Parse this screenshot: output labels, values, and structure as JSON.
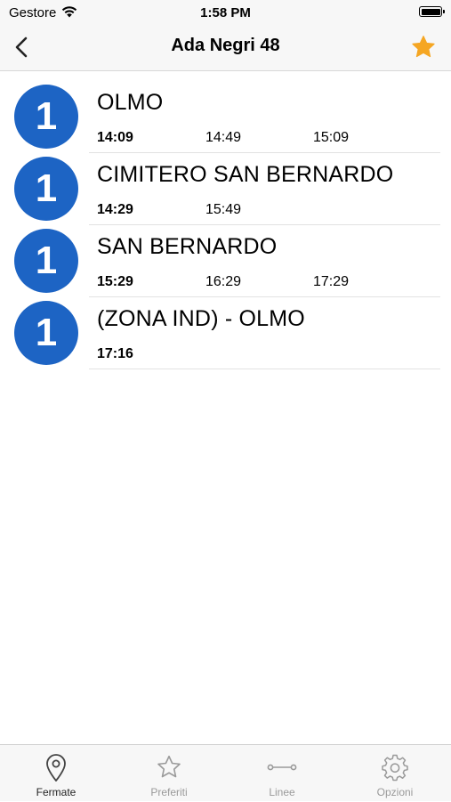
{
  "status": {
    "carrier": "Gestore",
    "time": "1:58 PM"
  },
  "nav": {
    "title": "Ada Negri 48",
    "favorite_color": "#f5a623"
  },
  "colors": {
    "line_badge": "#1d64c4"
  },
  "departures": [
    {
      "line": "1",
      "destination": "OLMO",
      "times": [
        "14:09",
        "14:49",
        "15:09"
      ]
    },
    {
      "line": "1",
      "destination": "CIMITERO SAN BERNARDO",
      "times": [
        "14:29",
        "15:49"
      ]
    },
    {
      "line": "1",
      "destination": "SAN BERNARDO",
      "times": [
        "15:29",
        "16:29",
        "17:29"
      ]
    },
    {
      "line": "1",
      "destination": "(ZONA IND) - OLMO",
      "times": [
        "17:16"
      ]
    }
  ],
  "tabs": [
    {
      "label": "Fermate",
      "icon": "location-pin-icon",
      "active": true
    },
    {
      "label": "Preferiti",
      "icon": "star-outline-icon",
      "active": false
    },
    {
      "label": "Linee",
      "icon": "line-route-icon",
      "active": false
    },
    {
      "label": "Opzioni",
      "icon": "gear-icon",
      "active": false
    }
  ]
}
